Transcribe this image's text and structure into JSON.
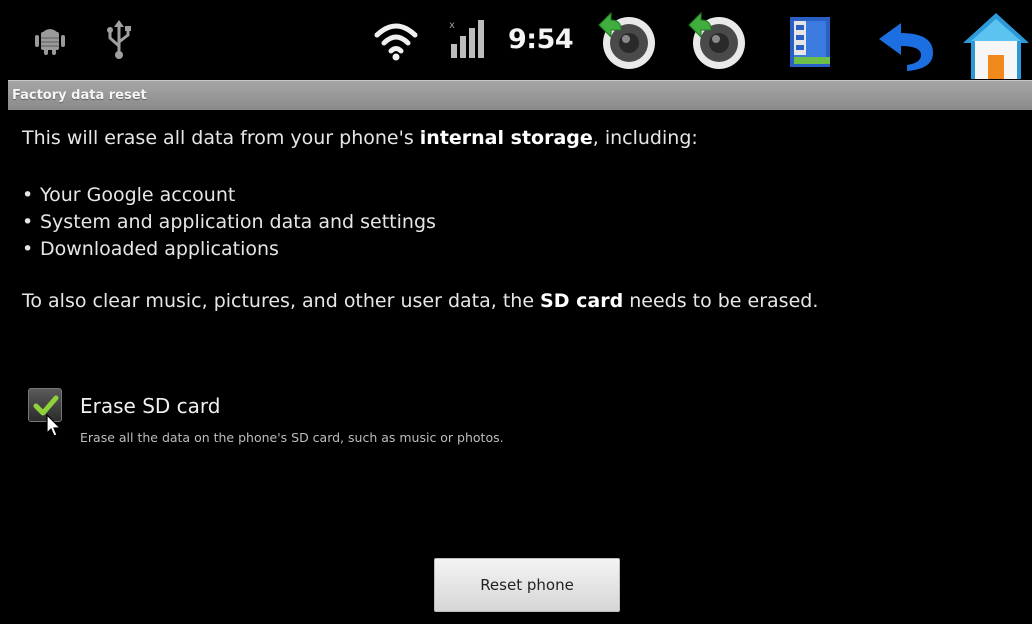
{
  "status_bar": {
    "time": "9:54",
    "icons": [
      "android-debug-icon",
      "usb-icon",
      "wifi-icon",
      "signal-icon",
      "volume-down-icon",
      "volume-up-icon",
      "menu-icon",
      "back-icon",
      "home-icon"
    ]
  },
  "title_bar": {
    "title": "Factory data reset"
  },
  "content": {
    "intro_prefix": "This will erase all data from your phone's ",
    "intro_bold": "internal storage",
    "intro_suffix": ", including:",
    "bullets": [
      "Your Google account",
      "System and application data and settings",
      "Downloaded applications"
    ],
    "sd_note_prefix": "To also clear music, pictures, and other user data, the ",
    "sd_note_bold": "SD card",
    "sd_note_suffix": " needs to be erased."
  },
  "erase_sd": {
    "checked": true,
    "title": "Erase SD card",
    "subtitle": "Erase all the data on the phone's SD card, such as music or photos."
  },
  "reset_button": {
    "label": "Reset phone"
  },
  "colors": {
    "background": "#000000",
    "title_bar": "#9a9a9a",
    "check_green": "#8fd23a",
    "home_orange": "#f08a1c",
    "back_blue": "#1c6fe0"
  }
}
